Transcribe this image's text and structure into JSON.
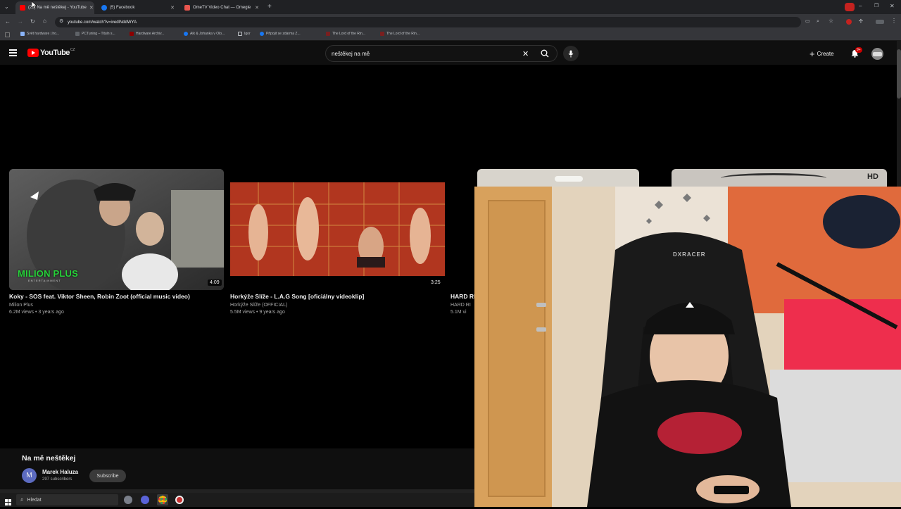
{
  "browser": {
    "tabs": [
      {
        "title": "(22) Na mě neštěkej - YouTube",
        "color": "#ff0000"
      },
      {
        "title": "(5) Facebook",
        "color": "#1877f2"
      },
      {
        "title": "OmeTV Video Chat — Omegle",
        "color": "#e8554e"
      }
    ],
    "url": "youtube.com/watch?v=ivedlNddWYA",
    "bookmarks": [
      {
        "label": "Svět hardware | ho...",
        "color": "#8ab4f8"
      },
      {
        "label": "PCTuning – Tituln s...",
        "color": "#5f6368"
      },
      {
        "label": "Hardware Archiv...",
        "color": "#8b0000"
      },
      {
        "label": "Aik & Johanka v Olo...",
        "color": "#1877f2"
      },
      {
        "label": "Igor",
        "color": "#bdc1c6"
      },
      {
        "label": "Připojit se zdarma Z...",
        "color": "#1877f2"
      },
      {
        "label": "The Lord of the Rin...",
        "color": "#7a1f1f"
      },
      {
        "label": "The Lord of the Rin...",
        "color": "#7a1f1f"
      }
    ]
  },
  "youtube": {
    "logo_text": "YouTube",
    "logo_badge": "CZ",
    "search_value": "neštěkej na mě",
    "create_label": "Create",
    "notification_count": "9+",
    "videos": [
      {
        "title": "Koky - SOS feat. Viktor Sheen, Robin Zoot (official music video)",
        "channel": "Milion Plus",
        "meta": "6.2M views • 3 years ago",
        "duration": "4:09",
        "thumb_text": "MILION PLUS",
        "thumb_sub": "ENTERTAINMENT"
      },
      {
        "title": "Horkýže Slíže - L.A.G Song [oficiálny videoklip]",
        "channel": "Horkýže Slíže (OFFICIAL)",
        "meta": "5.5M views • 9 years ago",
        "duration": "3:25"
      },
      {
        "title": "HARD RI",
        "channel": "HARD RI",
        "meta": "5.1M vi"
      }
    ],
    "hd_badge": "HD",
    "video_title": "Na mě neštěkej",
    "channel_name": "Marek Haluza",
    "channel_initial": "M",
    "subscribers": "297 subscribers",
    "subscribe_label": "Subscribe"
  },
  "webcam": {
    "chair_brand": "DXRACER"
  },
  "taskbar": {
    "search_placeholder": "Hledat"
  }
}
